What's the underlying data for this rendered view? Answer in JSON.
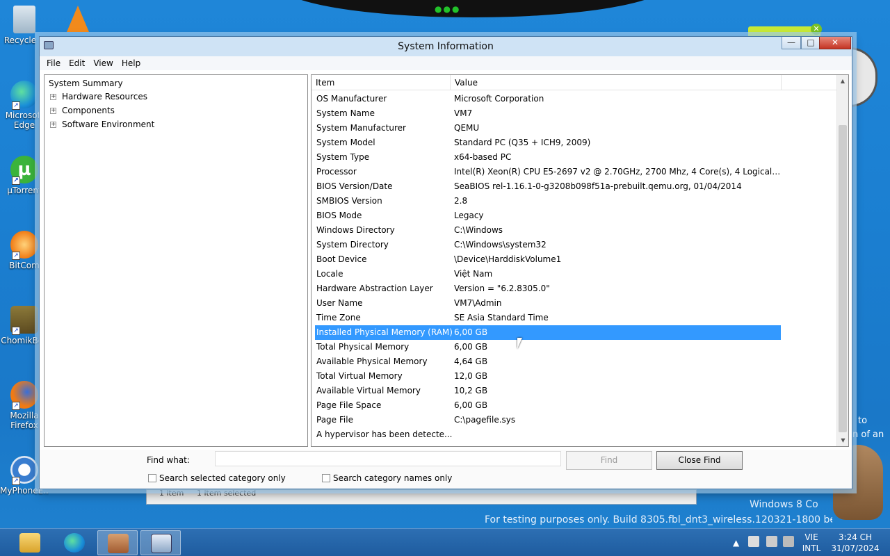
{
  "window": {
    "title": "System Information",
    "minimize": "—",
    "maximize": "□",
    "close": "✕"
  },
  "menu": [
    "File",
    "Edit",
    "View",
    "Help"
  ],
  "tree": {
    "root": "System Summary",
    "nodes": [
      "Hardware Resources",
      "Components",
      "Software Environment"
    ],
    "expander": "+"
  },
  "table": {
    "headers": {
      "item": "Item",
      "value": "Value"
    },
    "rows": [
      {
        "item": "OS Manufacturer",
        "value": "Microsoft Corporation"
      },
      {
        "item": "System Name",
        "value": "VM7"
      },
      {
        "item": "System Manufacturer",
        "value": "QEMU"
      },
      {
        "item": "System Model",
        "value": "Standard PC (Q35 + ICH9, 2009)"
      },
      {
        "item": "System Type",
        "value": "x64-based PC"
      },
      {
        "item": "Processor",
        "value": "Intel(R) Xeon(R) CPU E5-2697 v2 @ 2.70GHz, 2700 Mhz, 4 Core(s), 4 Logical Pr..."
      },
      {
        "item": "BIOS Version/Date",
        "value": "SeaBIOS rel-1.16.1-0-g3208b098f51a-prebuilt.qemu.org, 01/04/2014"
      },
      {
        "item": "SMBIOS Version",
        "value": "2.8"
      },
      {
        "item": "BIOS Mode",
        "value": "Legacy"
      },
      {
        "item": "Windows Directory",
        "value": "C:\\Windows"
      },
      {
        "item": "System Directory",
        "value": "C:\\Windows\\system32"
      },
      {
        "item": "Boot Device",
        "value": "\\Device\\HarddiskVolume1"
      },
      {
        "item": "Locale",
        "value": "Việt Nam"
      },
      {
        "item": "Hardware Abstraction Layer",
        "value": "Version = \"6.2.8305.0\""
      },
      {
        "item": "User Name",
        "value": "VM7\\Admin"
      },
      {
        "item": "Time Zone",
        "value": "SE Asia Standard Time"
      },
      {
        "item": "Installed Physical Memory (RAM)",
        "value": "6,00 GB"
      },
      {
        "item": "Total Physical Memory",
        "value": "6,00 GB"
      },
      {
        "item": "Available Physical Memory",
        "value": "4,64 GB"
      },
      {
        "item": "Total Virtual Memory",
        "value": "12,0 GB"
      },
      {
        "item": "Available Virtual Memory",
        "value": "10,2 GB"
      },
      {
        "item": "Page File Space",
        "value": "6,00 GB"
      },
      {
        "item": "Page File",
        "value": "C:\\pagefile.sys"
      },
      {
        "item": "A hypervisor has been detecte...",
        "value": ""
      }
    ],
    "selected_index": 16
  },
  "find": {
    "label": "Find what:",
    "value": "",
    "find_button": "Find",
    "close_find_button": "Close Find",
    "check_selected": "Search selected category only",
    "check_names": "Search category names only"
  },
  "statusbar": {
    "count": "1 item",
    "selected": "1 item selected"
  },
  "desktop_icons": [
    {
      "label": "Recycle B",
      "icon": "recycle-bin-icon"
    },
    {
      "label": "Microsoft Edge",
      "icon": "edge-icon"
    },
    {
      "label": "µTorrent",
      "icon": "utorrent-icon"
    },
    {
      "label": "BitCom",
      "icon": "bitcomet-icon"
    },
    {
      "label": "ChomikBox",
      "icon": "chomikbox-icon"
    },
    {
      "label": "Mozilla Firefox",
      "icon": "firefox-icon"
    },
    {
      "label": "MyPhoneE...",
      "icon": "myphoneexplorer-icon"
    }
  ],
  "side_text": [
    "to",
    "n of an"
  ],
  "watermark": {
    "line1": "Windows 8 Co",
    "line2": "For testing purposes only. Build 8305.fbl_dnt3_wireless.120321-1800 be"
  },
  "taskbar": {
    "items": [
      "file-explorer-icon",
      "edge-icon",
      "installer-icon",
      "system-information-icon"
    ],
    "tray": {
      "lang_top": "VIE",
      "lang_bottom": "INTL",
      "time": "3:24 CH",
      "date": "31/07/2024",
      "chevron": "▲"
    }
  },
  "colors": {
    "selection": "#3399ff",
    "taskbar": "#2d6fb3",
    "desktop": "#1b7fd1"
  }
}
